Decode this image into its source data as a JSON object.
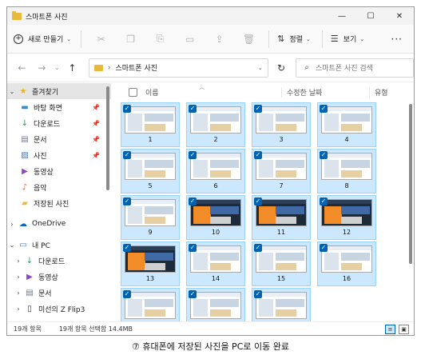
{
  "window": {
    "title": "스마트폰 사진",
    "minimize": "—",
    "maximize": "☐",
    "close": "✕"
  },
  "toolbar": {
    "new_label": "새로 만들기",
    "sort_label": "정렬",
    "view_label": "보기",
    "more": "···",
    "icons": [
      "cut-icon",
      "copy-icon",
      "paste-icon",
      "rename-icon",
      "share-icon",
      "delete-icon"
    ]
  },
  "address": {
    "path": "스마트폰 사진",
    "search_placeholder": "스마트폰 사진 검색"
  },
  "nav": {
    "quick_access": "즐겨찾기",
    "items": [
      {
        "label": "바탕 화면",
        "icon": "desktop-icon",
        "pinned": true
      },
      {
        "label": "다운로드",
        "icon": "download-icon",
        "pinned": true
      },
      {
        "label": "문서",
        "icon": "document-icon",
        "pinned": true
      },
      {
        "label": "사진",
        "icon": "pictures-icon",
        "pinned": true
      },
      {
        "label": "동영상",
        "icon": "video-icon",
        "pinned": false
      },
      {
        "label": "음악",
        "icon": "music-icon",
        "pinned": false
      },
      {
        "label": "저장된 사진",
        "icon": "folder-icon",
        "pinned": false
      }
    ],
    "onedrive": "OneDrive",
    "this_pc": "내 PC",
    "pc_items": [
      {
        "label": "다운로드",
        "icon": "download-icon"
      },
      {
        "label": "동영상",
        "icon": "video-icon"
      },
      {
        "label": "문서",
        "icon": "document-icon"
      },
      {
        "label": "미선의 Z Flip3",
        "icon": "phone-icon"
      }
    ]
  },
  "columns": {
    "name": "이름",
    "modified": "수정한 날짜",
    "type": "유형"
  },
  "files": [
    {
      "label": "1",
      "dark": false
    },
    {
      "label": "2",
      "dark": false
    },
    {
      "label": "3",
      "dark": false
    },
    {
      "label": "4",
      "dark": false
    },
    {
      "label": "5",
      "dark": false
    },
    {
      "label": "6",
      "dark": false
    },
    {
      "label": "7",
      "dark": false
    },
    {
      "label": "8",
      "dark": false
    },
    {
      "label": "9",
      "dark": false
    },
    {
      "label": "10",
      "dark": true
    },
    {
      "label": "11",
      "dark": true
    },
    {
      "label": "12",
      "dark": true
    },
    {
      "label": "13",
      "dark": true
    },
    {
      "label": "14",
      "dark": false
    },
    {
      "label": "15",
      "dark": false
    },
    {
      "label": "16",
      "dark": false
    },
    {
      "label": "",
      "dark": false
    },
    {
      "label": "",
      "dark": false
    },
    {
      "label": "",
      "dark": false
    }
  ],
  "status": {
    "count": "19개 항목",
    "selected": "19개 항목 선택함 14.4MB"
  },
  "caption": "⑦ 휴대폰에 저장된 사진을 PC로 이동 완료",
  "colors": {
    "selection": "#cce8ff",
    "selection_border": "#99d1ff",
    "accent": "#0063b1",
    "folder": "#e8b93a"
  }
}
